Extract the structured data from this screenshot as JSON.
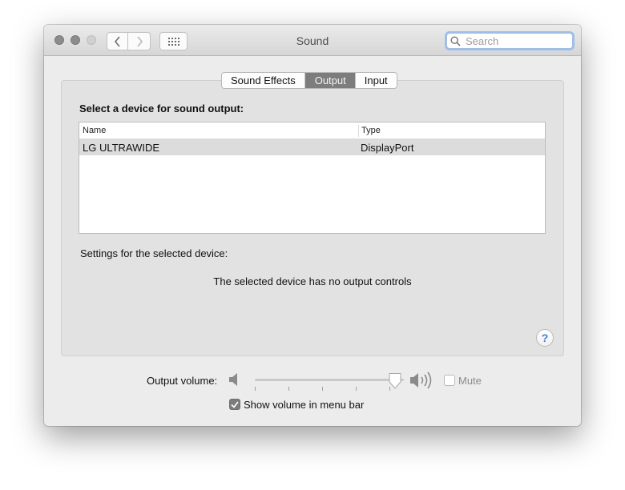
{
  "window": {
    "title": "Sound",
    "search_placeholder": "Search"
  },
  "toolbar": {
    "back_icon": "chevron-left",
    "forward_icon": "chevron-right",
    "show_all_icon": "grid-dots"
  },
  "tabs": [
    {
      "label": "Sound Effects",
      "active": false
    },
    {
      "label": "Output",
      "active": true
    },
    {
      "label": "Input",
      "active": false
    }
  ],
  "output": {
    "heading": "Select a device for sound output:",
    "columns": {
      "name": "Name",
      "type": "Type"
    },
    "devices": [
      {
        "name": "LG ULTRAWIDE",
        "type": "DisplayPort",
        "selected": true
      }
    ],
    "settings_label": "Settings for the selected device:",
    "no_controls_message": "The selected device has no output controls",
    "help_label": "?"
  },
  "volume": {
    "label": "Output volume:",
    "level": 0.94,
    "mute_label": "Mute",
    "muted": false,
    "show_in_menu_bar_label": "Show volume in menu bar",
    "show_in_menu_bar": true
  },
  "colors": {
    "active_tab": "#7d7d7d",
    "help_accent": "#3c7fe0",
    "search_focus": "#9fbfe6"
  }
}
